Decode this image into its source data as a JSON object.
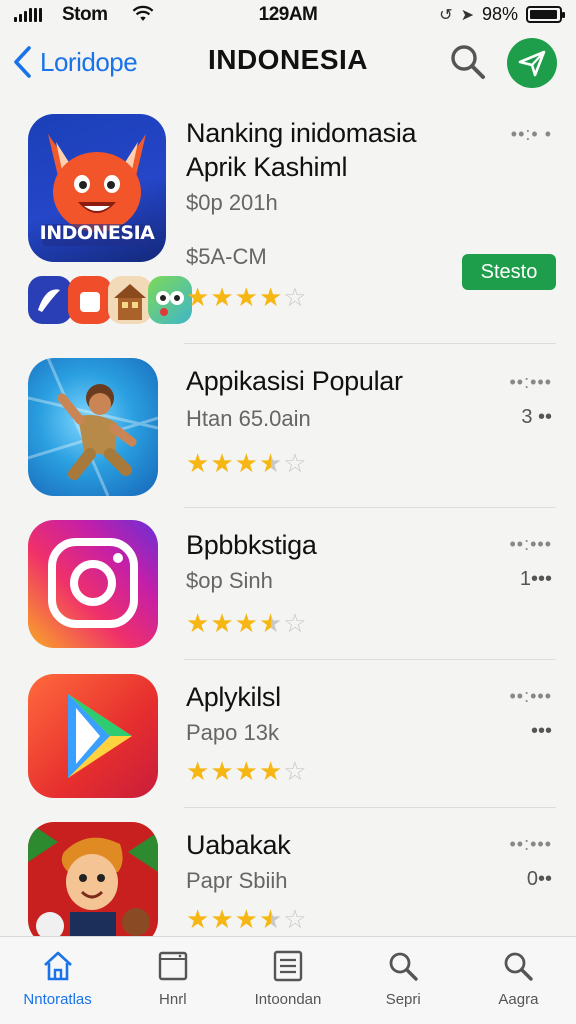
{
  "status_bar": {
    "carrier": "Stom",
    "time": "129AM",
    "battery": "98%",
    "battery_level": 0.98
  },
  "nav": {
    "back_label": "Loridope",
    "title": "INDONESIA",
    "icons": {
      "back": "chevron-left-icon",
      "search": "search-icon",
      "send": "send-icon"
    }
  },
  "apps": [
    {
      "name_line1": "Nanking inidomasia",
      "name_line2": "Aprik Kashiml",
      "subtitle": "$0p 201h",
      "price": "$5A-CM",
      "rating": 4,
      "action": "Stesto",
      "meta": "••:• •",
      "icon_text": "INDONESIA"
    },
    {
      "name_line1": "Appikasisi Popular",
      "subtitle": "Htan 65.0ain",
      "rating": 3.5,
      "meta": "••:•••",
      "rank": "3 ••"
    },
    {
      "name_line1": "Bpbbkstiga",
      "subtitle": "$op Sinh",
      "rating": 3.5,
      "meta": "••:•••",
      "rank": "1•••"
    },
    {
      "name_line1": "Aplykilsl",
      "subtitle": "Papo 13k",
      "rating": 4,
      "meta": "••:•••",
      "rank": "•••"
    },
    {
      "name_line1": "Uabakak",
      "subtitle": "Papr Sbiih",
      "rating": 3.5,
      "meta": "••:•••",
      "rank": "0••"
    }
  ],
  "tabs": [
    {
      "label": "Nntoratlas",
      "icon": "home-icon",
      "active": true
    },
    {
      "label": "Hnrl",
      "icon": "window-icon",
      "active": false
    },
    {
      "label": "Intoondan",
      "icon": "list-icon",
      "active": false
    },
    {
      "label": "Sepri",
      "icon": "search-icon",
      "active": false
    },
    {
      "label": "Aagra",
      "icon": "search-icon",
      "active": false
    }
  ],
  "colors": {
    "accent": "#1a73e8",
    "green": "#1e9e4a",
    "star": "#f6b614"
  }
}
